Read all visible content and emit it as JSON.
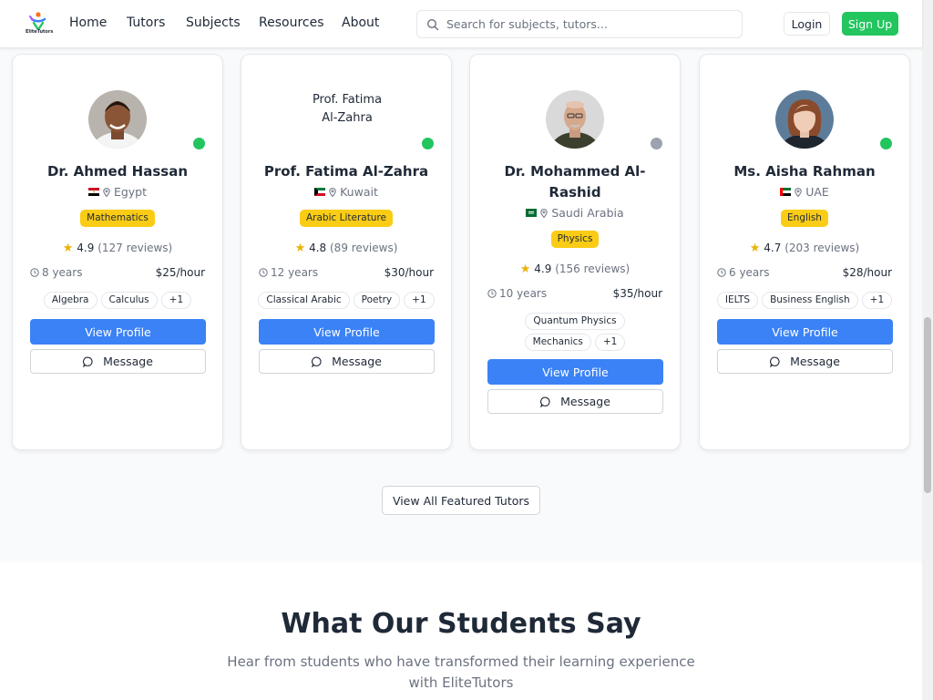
{
  "nav": {
    "logo_text": "EliteTutors",
    "links": [
      "Home",
      "Tutors",
      "Subjects",
      "Resources",
      "About"
    ],
    "search_placeholder": "Search for subjects, tutors...",
    "login": "Login",
    "signup": "Sign Up"
  },
  "tutors": [
    {
      "name": "Dr. Ahmed Hassan",
      "country": "Egypt",
      "subject": "Mathematics",
      "rating": "4.9",
      "reviews": "(127 reviews)",
      "experience": "8 years",
      "rate": "$25/hour",
      "tags": [
        "Algebra",
        "Calculus",
        "+1"
      ],
      "status": "online"
    },
    {
      "name": "Prof. Fatima Al-Zahra",
      "avatar_alt": "Prof. Fatima Al-Zahra",
      "country": "Kuwait",
      "subject": "Arabic Literature",
      "rating": "4.8",
      "reviews": "(89 reviews)",
      "experience": "12 years",
      "rate": "$30/hour",
      "tags": [
        "Classical Arabic",
        "Poetry",
        "+1"
      ],
      "status": "online"
    },
    {
      "name": "Dr. Mohammed Al-Rashid",
      "country": "Saudi Arabia",
      "subject": "Physics",
      "rating": "4.9",
      "reviews": "(156 reviews)",
      "experience": "10 years",
      "rate": "$35/hour",
      "tags": [
        "Quantum Physics",
        "Mechanics",
        "+1"
      ],
      "status": "offline"
    },
    {
      "name": "Ms. Aisha Rahman",
      "country": "UAE",
      "subject": "English",
      "rating": "4.7",
      "reviews": "(203 reviews)",
      "experience": "6 years",
      "rate": "$28/hour",
      "tags": [
        "IELTS",
        "Business English",
        "+1"
      ],
      "status": "online"
    }
  ],
  "buttons": {
    "view_profile": "View Profile",
    "message": "Message",
    "view_all": "View All Featured Tutors"
  },
  "testimonials": {
    "title": "What Our Students Say",
    "subtitle": "Hear from students who have transformed their learning experience with EliteTutors"
  },
  "colors": {
    "primary": "#3b82f6",
    "success": "#22c55e",
    "badge": "#facc15",
    "offline": "#9ca3af"
  }
}
